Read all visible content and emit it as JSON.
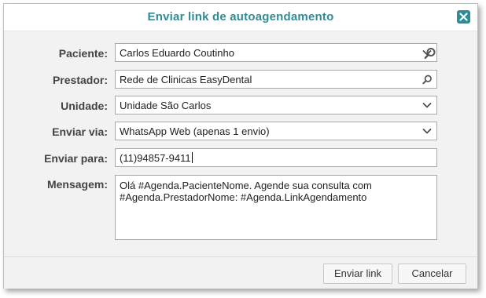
{
  "dialog": {
    "title": "Enviar link de autoagendamento",
    "close_icon": "close-icon",
    "accent_color": "#2e8c96"
  },
  "form": {
    "paciente": {
      "label": "Paciente:",
      "value": "Carlos Eduardo Coutinho"
    },
    "prestador": {
      "label": "Prestador:",
      "value": "Rede de Clinicas EasyDental"
    },
    "unidade": {
      "label": "Unidade:",
      "value": "Unidade São Carlos"
    },
    "enviar_via": {
      "label": "Enviar via:",
      "value": "WhatsApp Web (apenas 1 envio)"
    },
    "enviar_para": {
      "label": "Enviar para:",
      "value": "(11)94857-9411"
    },
    "mensagem": {
      "label": "Mensagem:",
      "value": "Olá #Agenda.PacienteNome. Agende sua consulta com #Agenda.PrestadorNome: #Agenda.LinkAgendamento"
    }
  },
  "footer": {
    "send_label": "Enviar link",
    "cancel_label": "Cancelar"
  }
}
